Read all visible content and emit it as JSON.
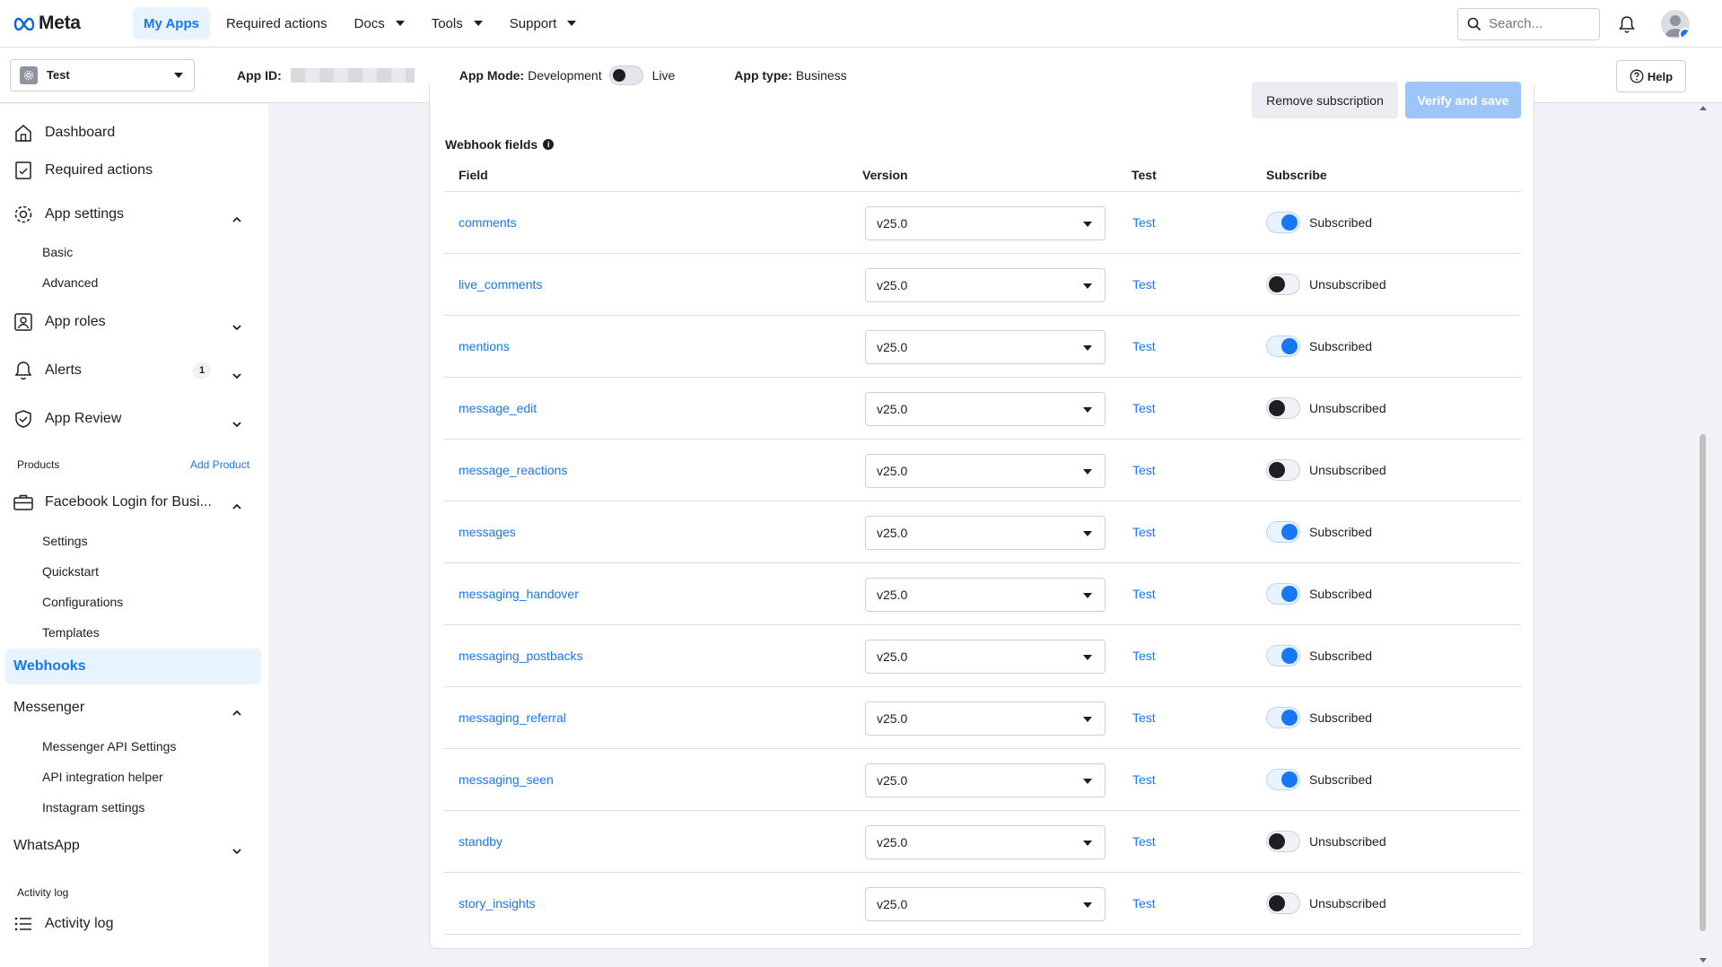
{
  "brand": {
    "logo_text": "Meta"
  },
  "topnav": [
    {
      "label": "My Apps",
      "active": true,
      "dropdown": false
    },
    {
      "label": "Required actions",
      "active": false,
      "dropdown": false
    },
    {
      "label": "Docs",
      "active": false,
      "dropdown": true
    },
    {
      "label": "Tools",
      "active": false,
      "dropdown": true
    },
    {
      "label": "Support",
      "active": false,
      "dropdown": true
    }
  ],
  "search": {
    "placeholder": "Search..."
  },
  "subbar": {
    "app_name": "Test",
    "app_id_label": "App ID:",
    "app_mode_label": "App Mode:",
    "app_mode_value": "Development",
    "app_mode_live": "Live",
    "app_type_label": "App type:",
    "app_type_value": "Business",
    "help_label": "Help"
  },
  "sidebar": {
    "dashboard": "Dashboard",
    "required_actions": "Required actions",
    "app_settings": "App settings",
    "basic": "Basic",
    "advanced": "Advanced",
    "app_roles": "App roles",
    "alerts": "Alerts",
    "alerts_count": "1",
    "app_review": "App Review",
    "products": "Products",
    "add_product": "Add Product",
    "fb_login": "Facebook Login for Busi...",
    "settings": "Settings",
    "quickstart": "Quickstart",
    "configurations": "Configurations",
    "templates": "Templates",
    "webhooks": "Webhooks",
    "messenger": "Messenger",
    "messenger_api": "Messenger API Settings",
    "api_helper": "API integration helper",
    "instagram_settings": "Instagram settings",
    "whatsapp": "WhatsApp",
    "activity_log_section": "Activity log",
    "activity_log": "Activity log"
  },
  "actions": {
    "remove": "Remove subscription",
    "verify": "Verify and save"
  },
  "webhook": {
    "title": "Webhook fields",
    "headers": {
      "field": "Field",
      "version": "Version",
      "test": "Test",
      "subscribe": "Subscribe"
    },
    "rows": [
      {
        "field": "comments",
        "version": "v25.0",
        "test": "Test",
        "subscribed": true,
        "status": "Subscribed"
      },
      {
        "field": "live_comments",
        "version": "v25.0",
        "test": "Test",
        "subscribed": false,
        "status": "Unsubscribed"
      },
      {
        "field": "mentions",
        "version": "v25.0",
        "test": "Test",
        "subscribed": true,
        "status": "Subscribed"
      },
      {
        "field": "message_edit",
        "version": "v25.0",
        "test": "Test",
        "subscribed": false,
        "status": "Unsubscribed"
      },
      {
        "field": "message_reactions",
        "version": "v25.0",
        "test": "Test",
        "subscribed": false,
        "status": "Unsubscribed"
      },
      {
        "field": "messages",
        "version": "v25.0",
        "test": "Test",
        "subscribed": true,
        "status": "Subscribed"
      },
      {
        "field": "messaging_handover",
        "version": "v25.0",
        "test": "Test",
        "subscribed": true,
        "status": "Subscribed"
      },
      {
        "field": "messaging_postbacks",
        "version": "v25.0",
        "test": "Test",
        "subscribed": true,
        "status": "Subscribed"
      },
      {
        "field": "messaging_referral",
        "version": "v25.0",
        "test": "Test",
        "subscribed": true,
        "status": "Subscribed"
      },
      {
        "field": "messaging_seen",
        "version": "v25.0",
        "test": "Test",
        "subscribed": true,
        "status": "Subscribed"
      },
      {
        "field": "standby",
        "version": "v25.0",
        "test": "Test",
        "subscribed": false,
        "status": "Unsubscribed"
      },
      {
        "field": "story_insights",
        "version": "v25.0",
        "test": "Test",
        "subscribed": false,
        "status": "Unsubscribed"
      }
    ]
  },
  "colors": {
    "accent": "#1877f2",
    "accent_light": "#e7f3ff",
    "border": "#dadde1",
    "background": "#f0f2f5"
  }
}
